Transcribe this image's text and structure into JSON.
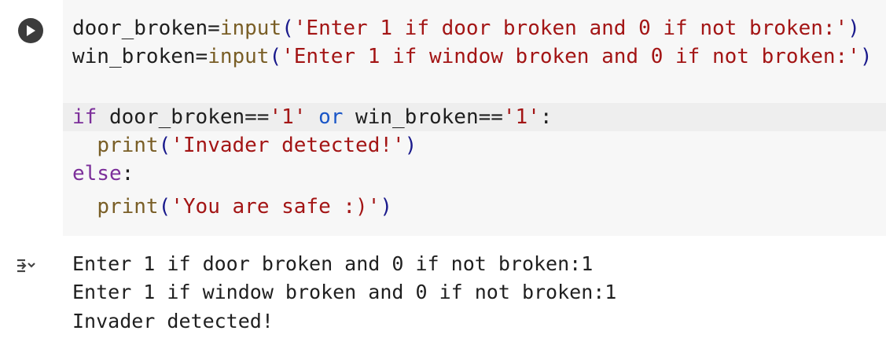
{
  "cell": {
    "code_lines": [
      {
        "segments": [
          {
            "t": "door_broken=",
            "c": "plain"
          },
          {
            "t": "input",
            "c": "fn"
          },
          {
            "t": "(",
            "c": "paren"
          },
          {
            "t": "'Enter 1 if door broken and 0 if not broken:'",
            "c": "str"
          },
          {
            "t": ")",
            "c": "paren"
          }
        ]
      },
      {
        "segments": [
          {
            "t": "win_broken=",
            "c": "plain"
          },
          {
            "t": "input",
            "c": "fn"
          },
          {
            "t": "(",
            "c": "paren"
          },
          {
            "t": "'Enter 1 if window broken and 0 if not broken:'",
            "c": "str"
          },
          {
            "t": ")",
            "c": "paren"
          }
        ]
      },
      {
        "segments": []
      },
      {
        "segments": [
          {
            "t": "if",
            "c": "kw"
          },
          {
            "t": " door_broken==",
            "c": "plain"
          },
          {
            "t": "'1'",
            "c": "str"
          },
          {
            "t": " ",
            "c": "plain"
          },
          {
            "t": "or",
            "c": "kwb"
          },
          {
            "t": " win_broken==",
            "c": "plain"
          },
          {
            "t": "'1'",
            "c": "str"
          },
          {
            "t": ":",
            "c": "plain"
          }
        ]
      },
      {
        "segments": [
          {
            "t": "  ",
            "c": "plain"
          },
          {
            "t": "print",
            "c": "fn"
          },
          {
            "t": "(",
            "c": "paren"
          },
          {
            "t": "'Invader detected!'",
            "c": "str"
          },
          {
            "t": ")",
            "c": "paren"
          }
        ]
      },
      {
        "segments": [
          {
            "t": "else",
            "c": "kw"
          },
          {
            "t": ":",
            "c": "plain"
          }
        ]
      },
      {
        "segments": [
          {
            "t": "  ",
            "c": "plain"
          },
          {
            "t": "print",
            "c": "fn"
          },
          {
            "t": "(",
            "c": "paren"
          },
          {
            "t": "'You are safe :)'",
            "c": "str"
          },
          {
            "t": ")",
            "c": "paren"
          }
        ]
      }
    ],
    "output_lines": [
      "Enter 1 if door broken and 0 if not broken:1",
      "Enter 1 if window broken and 0 if not broken:1",
      "Invader detected!"
    ]
  },
  "icons": {
    "run": "play-icon",
    "output_toggle": "output-collapse-icon"
  },
  "colors": {
    "code_bg": "#f7f7f7",
    "string": "#a31515",
    "function": "#795e26",
    "keyword": "#7c2f9a",
    "run_button": "#3c3c3c"
  }
}
